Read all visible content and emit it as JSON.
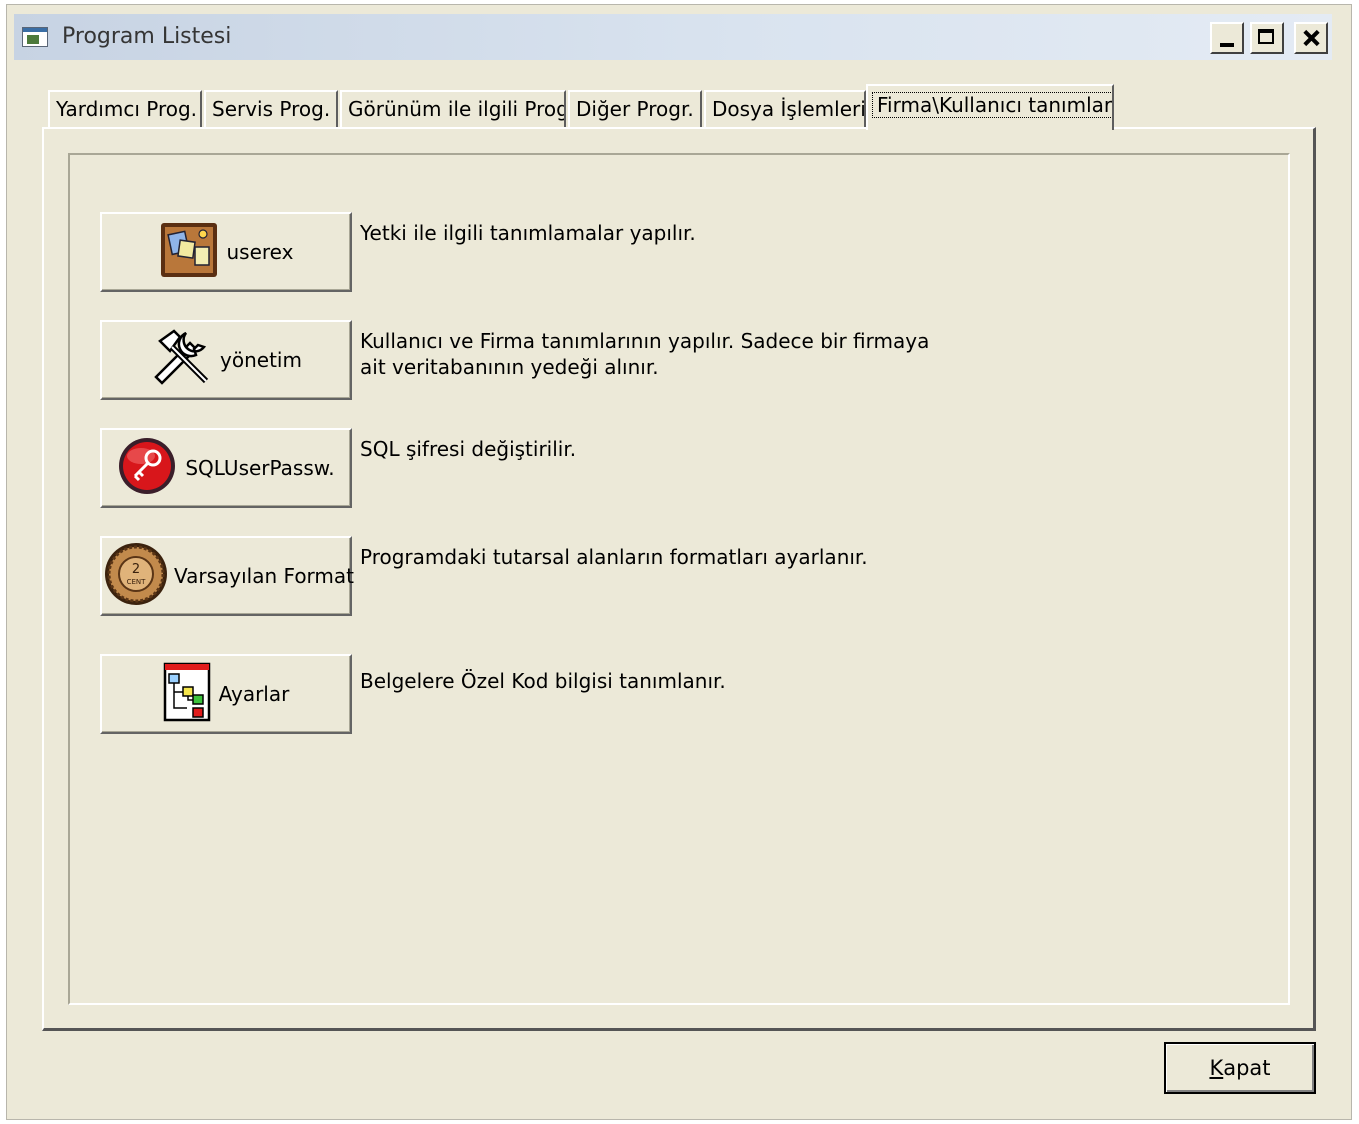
{
  "window": {
    "title": "Program Listesi"
  },
  "tabs": [
    {
      "label": "Yardımcı Prog."
    },
    {
      "label": "Servis Prog."
    },
    {
      "label": "Görünüm ile ilgili Prog."
    },
    {
      "label": "Diğer Progr."
    },
    {
      "label": "Dosya İşlemleri"
    },
    {
      "label": "Firma\\Kullanıcı tanımları",
      "active": true
    }
  ],
  "programs": [
    {
      "label": "userex",
      "icon": "corkboard-icon",
      "description": "Yetki ile ilgili tanımlamalar yapılır."
    },
    {
      "label": "yönetim",
      "icon": "tools-icon",
      "description_line1": "Kullanıcı ve Firma tanımlarının yapılır. Sadece bir firmaya",
      "description_line2": "ait veritabanının yedeği alınır."
    },
    {
      "label": "SQLUserPassw.",
      "icon": "key-icon",
      "description": "SQL şifresi değiştirilir."
    },
    {
      "label": "Varsayılan Format",
      "icon": "coin-icon",
      "description": "Programdaki tutarsal alanların formatları ayarlanır."
    },
    {
      "label": "Ayarlar",
      "icon": "tree-diagram-icon",
      "description": "Belgelere Özel Kod bilgisi tanımlanır."
    }
  ],
  "footer": {
    "close_hotkey": "K",
    "close_rest": "apat"
  }
}
